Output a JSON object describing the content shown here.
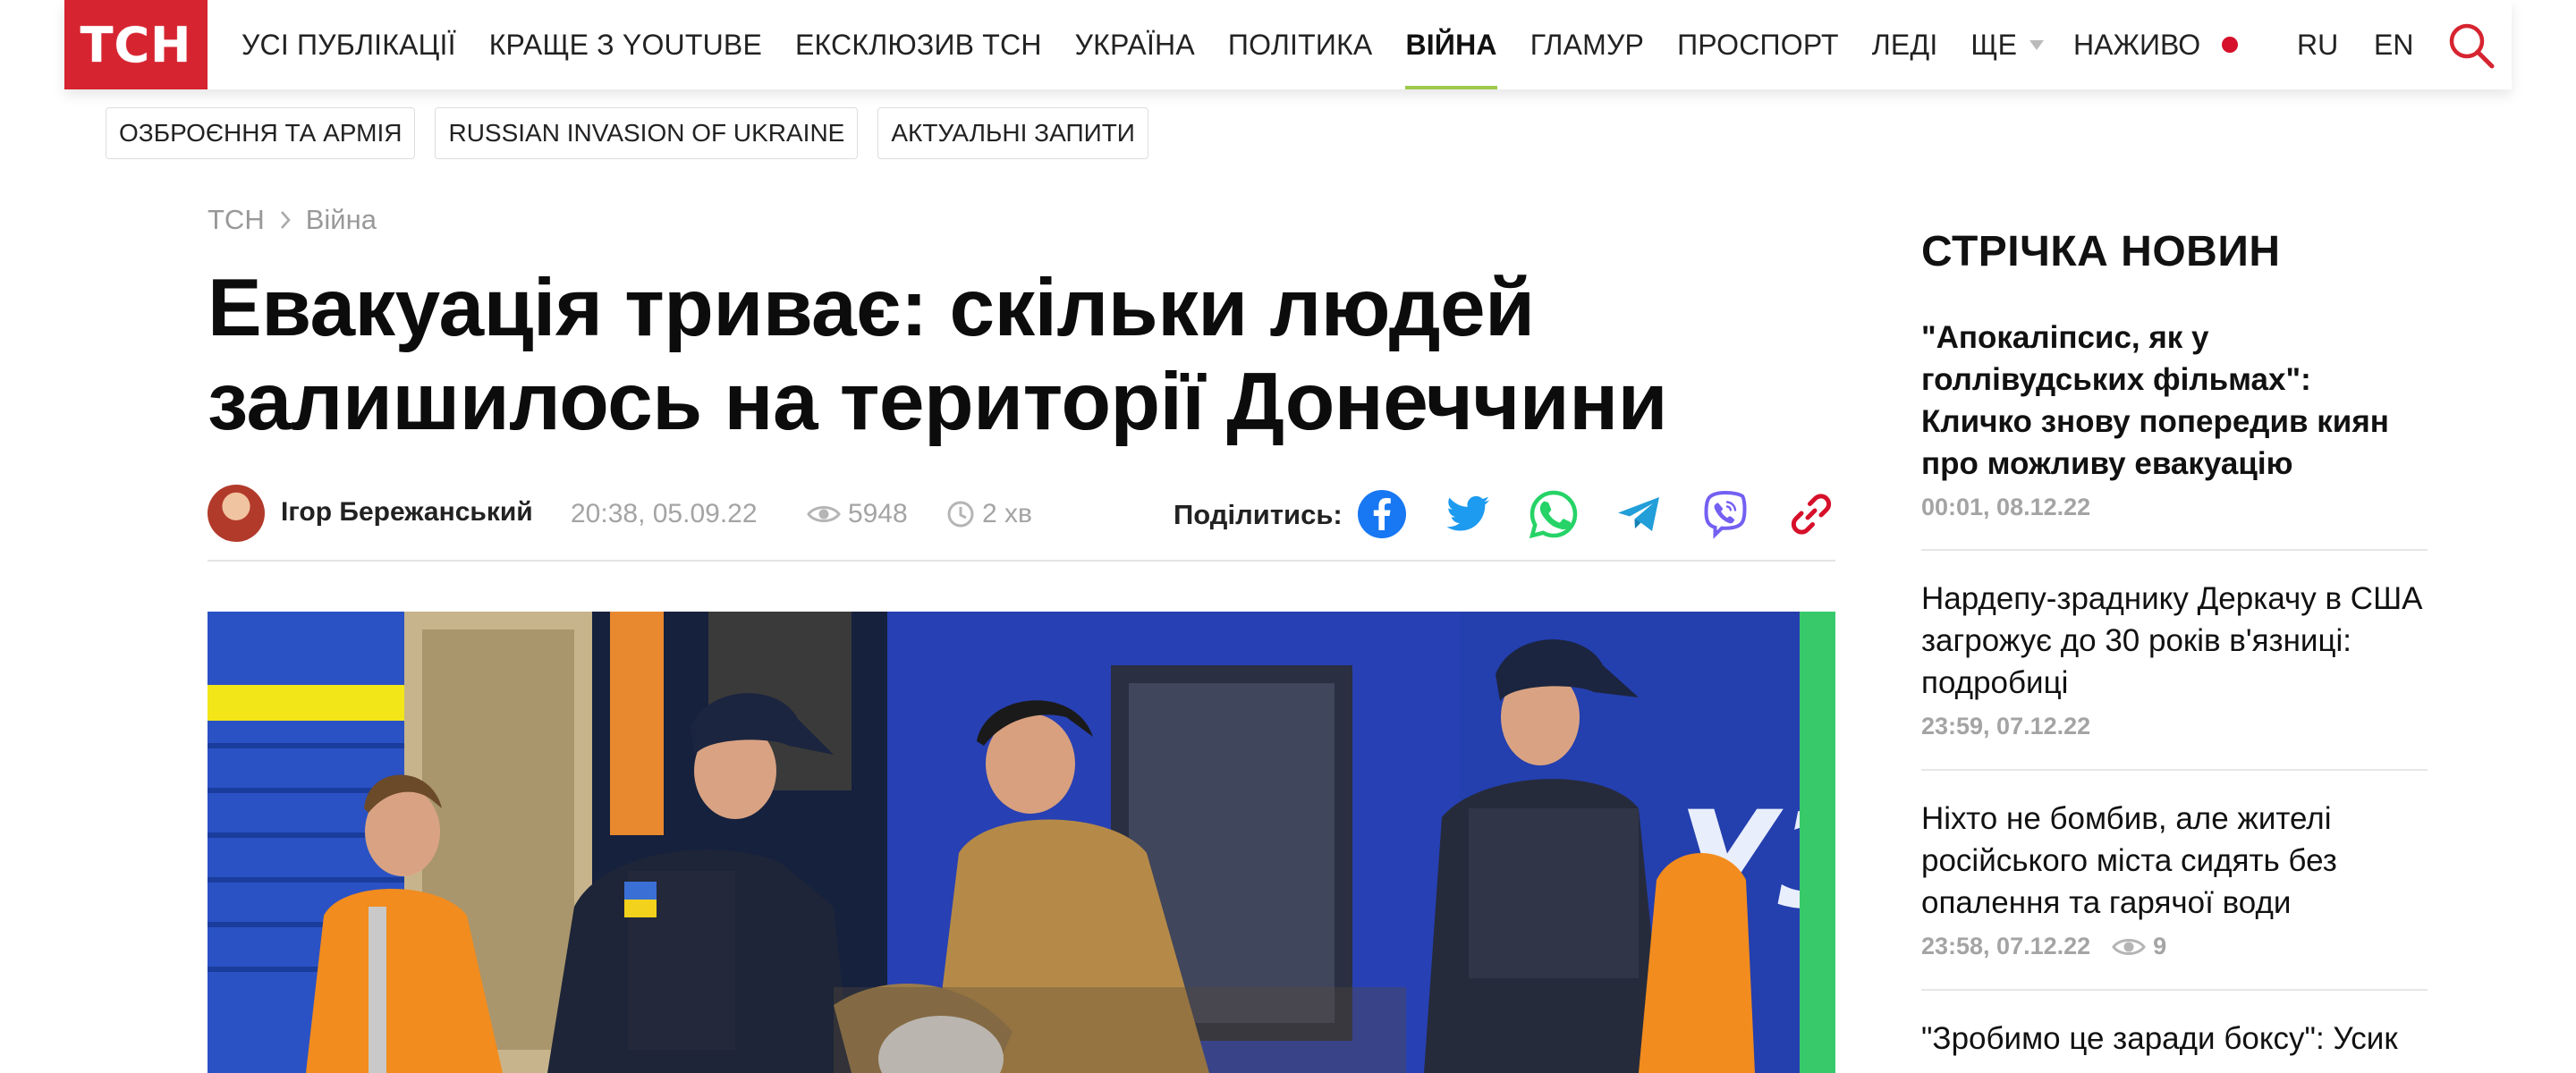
{
  "header": {
    "logo_text": "ТСН",
    "nav": [
      {
        "label": "УСІ ПУБЛІКАЦІЇ"
      },
      {
        "label": "КРАЩЕ З YOUTUBE"
      },
      {
        "label": "ЕКСКЛЮЗИВ ТСН"
      },
      {
        "label": "УКРАЇНА"
      },
      {
        "label": "ПОЛІТИКА"
      },
      {
        "label": "ВІЙНА",
        "active": true
      },
      {
        "label": "ГЛАМУР"
      },
      {
        "label": "ПРОСПОРТ"
      },
      {
        "label": "ЛЕДІ"
      },
      {
        "label": "ЩЕ"
      }
    ],
    "live_label": "НАЖИВО",
    "lang_ru": "RU",
    "lang_en": "EN",
    "accent_color": "#d62430"
  },
  "tags": [
    "ОЗБРОЄННЯ ТА АРМІЯ",
    "RUSSIAN INVASION OF UKRAINE",
    "АКТУАЛЬНІ ЗАПИТИ"
  ],
  "article": {
    "breadcrumb": [
      "ТСН",
      "Війна"
    ],
    "title": "Евакуація триває: скільки людей залишилось на території Донеччини",
    "author": "Ігор Бережанський",
    "date": "20:38, 05.09.22",
    "views": "5948",
    "read_time": "2 хв",
    "share_label": "Поділитись:",
    "share_icons": [
      "facebook-icon",
      "twitter-icon",
      "whatsapp-icon",
      "telegram-icon",
      "viber-icon",
      "copy-link-icon"
    ]
  },
  "sidebar": {
    "title": "СТРІЧКА НОВИН",
    "items": [
      {
        "text": "\"Апокаліпсис, як у голлівудських фільмах\": Кличко знову попередив киян про можливу евакуацію",
        "time": "00:01, 08.12.22",
        "bold": true
      },
      {
        "text": "Нардепу-зраднику Деркачу в США загрожує до 30 років в'язниці: подробиці",
        "time": "23:59, 07.12.22"
      },
      {
        "text": "Ніхто не бомбив, але жителі російського міста сидять без опалення та гарячої води",
        "time": "23:58, 07.12.22",
        "views": "9"
      },
      {
        "text": "\"Зробимо це заради боксу\": Усик"
      }
    ]
  }
}
